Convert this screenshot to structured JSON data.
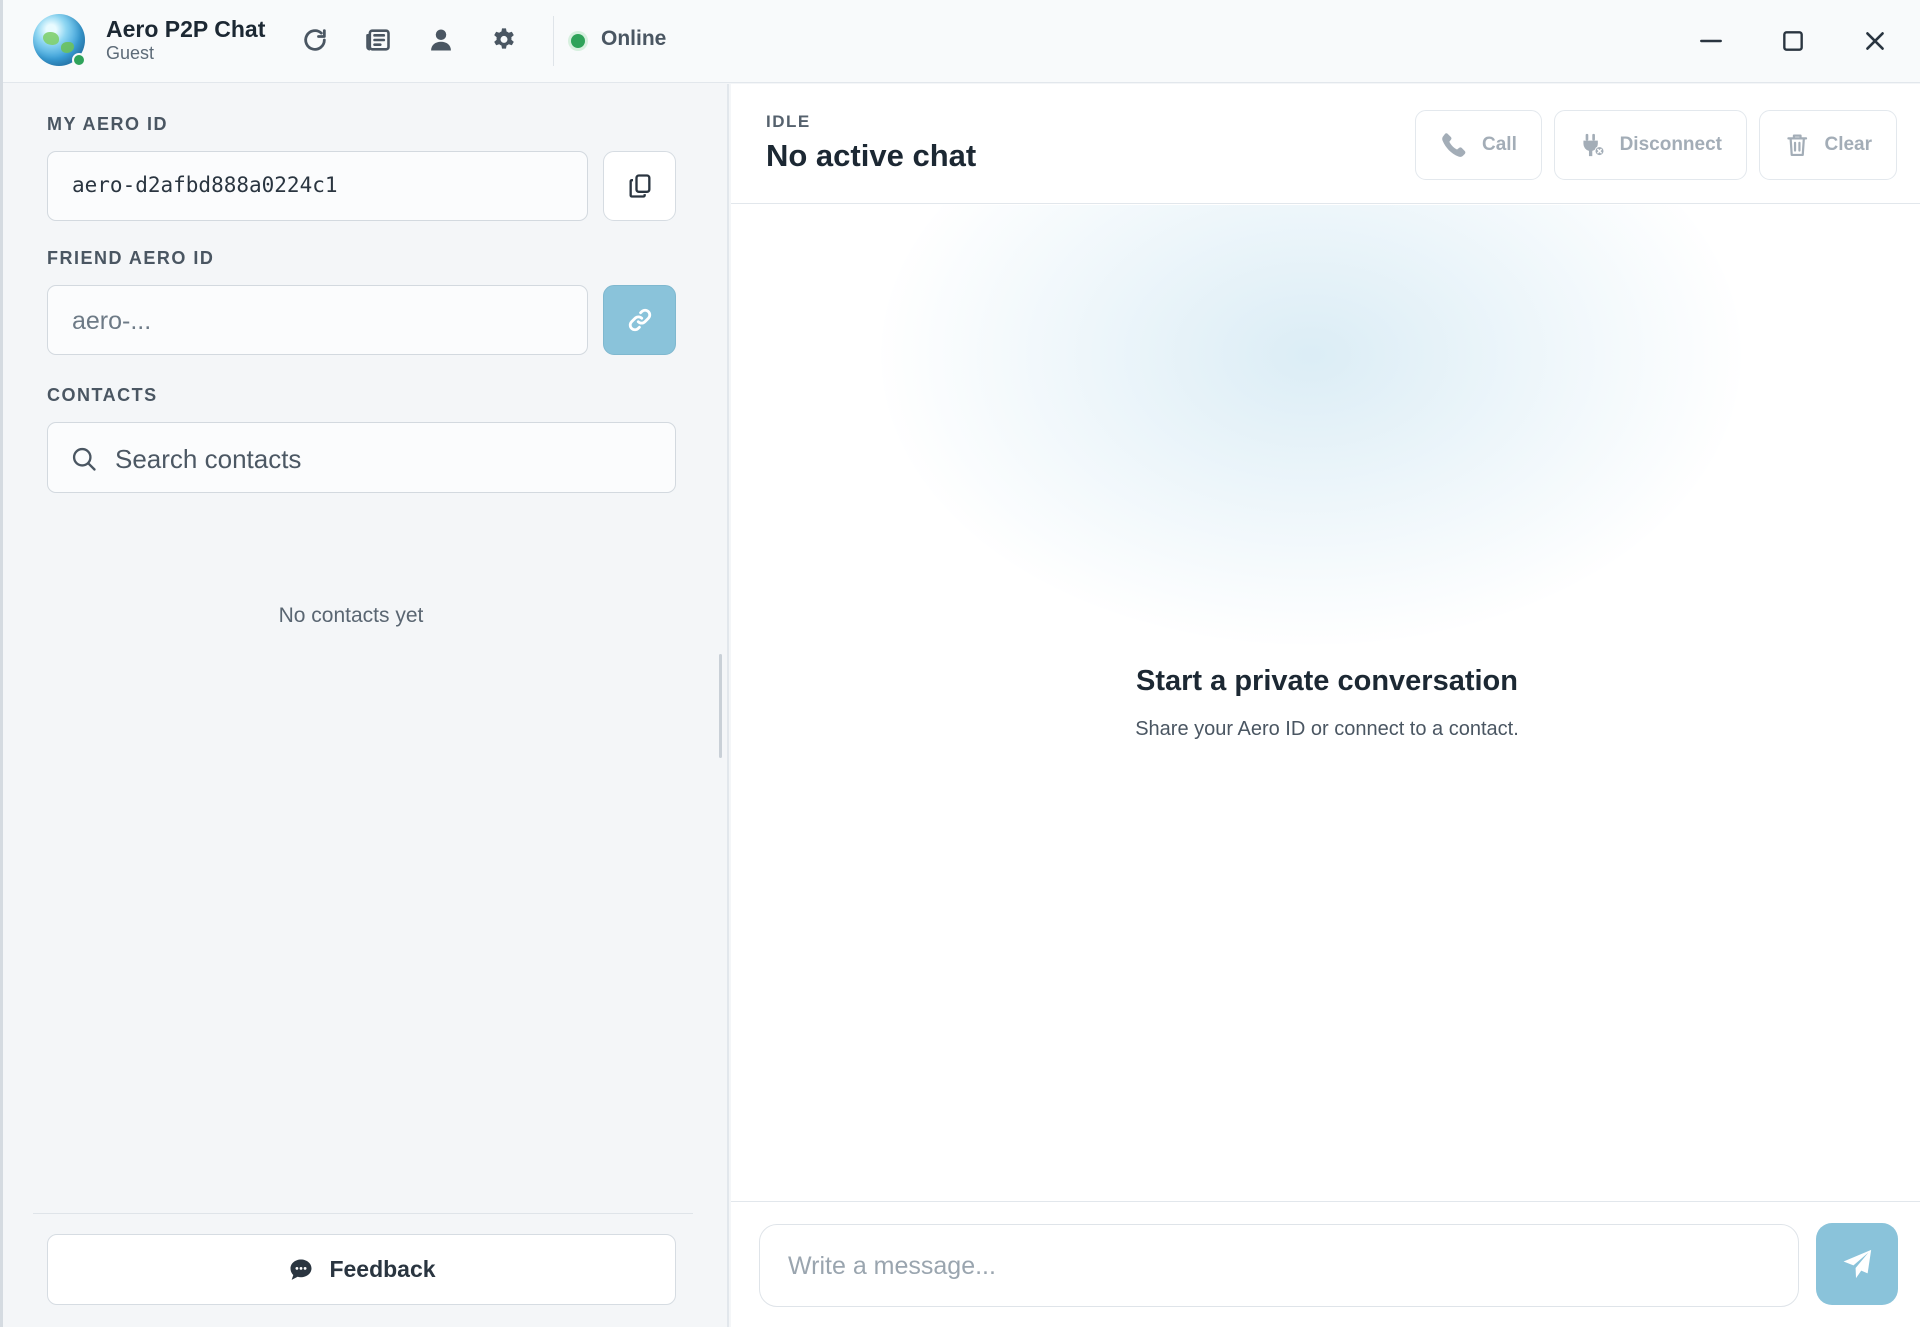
{
  "titlebar": {
    "app_name": "Aero P2P Chat",
    "user": "Guest",
    "status": "Online",
    "icons": [
      "refresh-icon",
      "news-icon",
      "profile-icon",
      "settings-icon"
    ],
    "window_controls": [
      "minimize-icon",
      "maximize-icon",
      "close-icon"
    ]
  },
  "sidebar": {
    "my_id_label": "MY AERO ID",
    "my_id_value": "aero-d2afbd888a0224c1",
    "friend_id_label": "FRIEND AERO ID",
    "friend_id_placeholder": "aero-...",
    "contacts_label": "CONTACTS",
    "search_placeholder": "Search contacts",
    "empty_contacts": "No contacts yet",
    "feedback_label": "Feedback"
  },
  "chat": {
    "state": "IDLE",
    "title": "No active chat",
    "actions": {
      "call": "Call",
      "disconnect": "Disconnect",
      "clear": "Clear"
    },
    "empty_title": "Start a private conversation",
    "empty_subtitle": "Share your Aero ID or connect to a contact.",
    "message_placeholder": "Write a message..."
  },
  "colors": {
    "accent": "#8ac3da",
    "online": "#2fa35a",
    "text_dark": "#1c2833",
    "disabled_text": "#a3adb7"
  }
}
